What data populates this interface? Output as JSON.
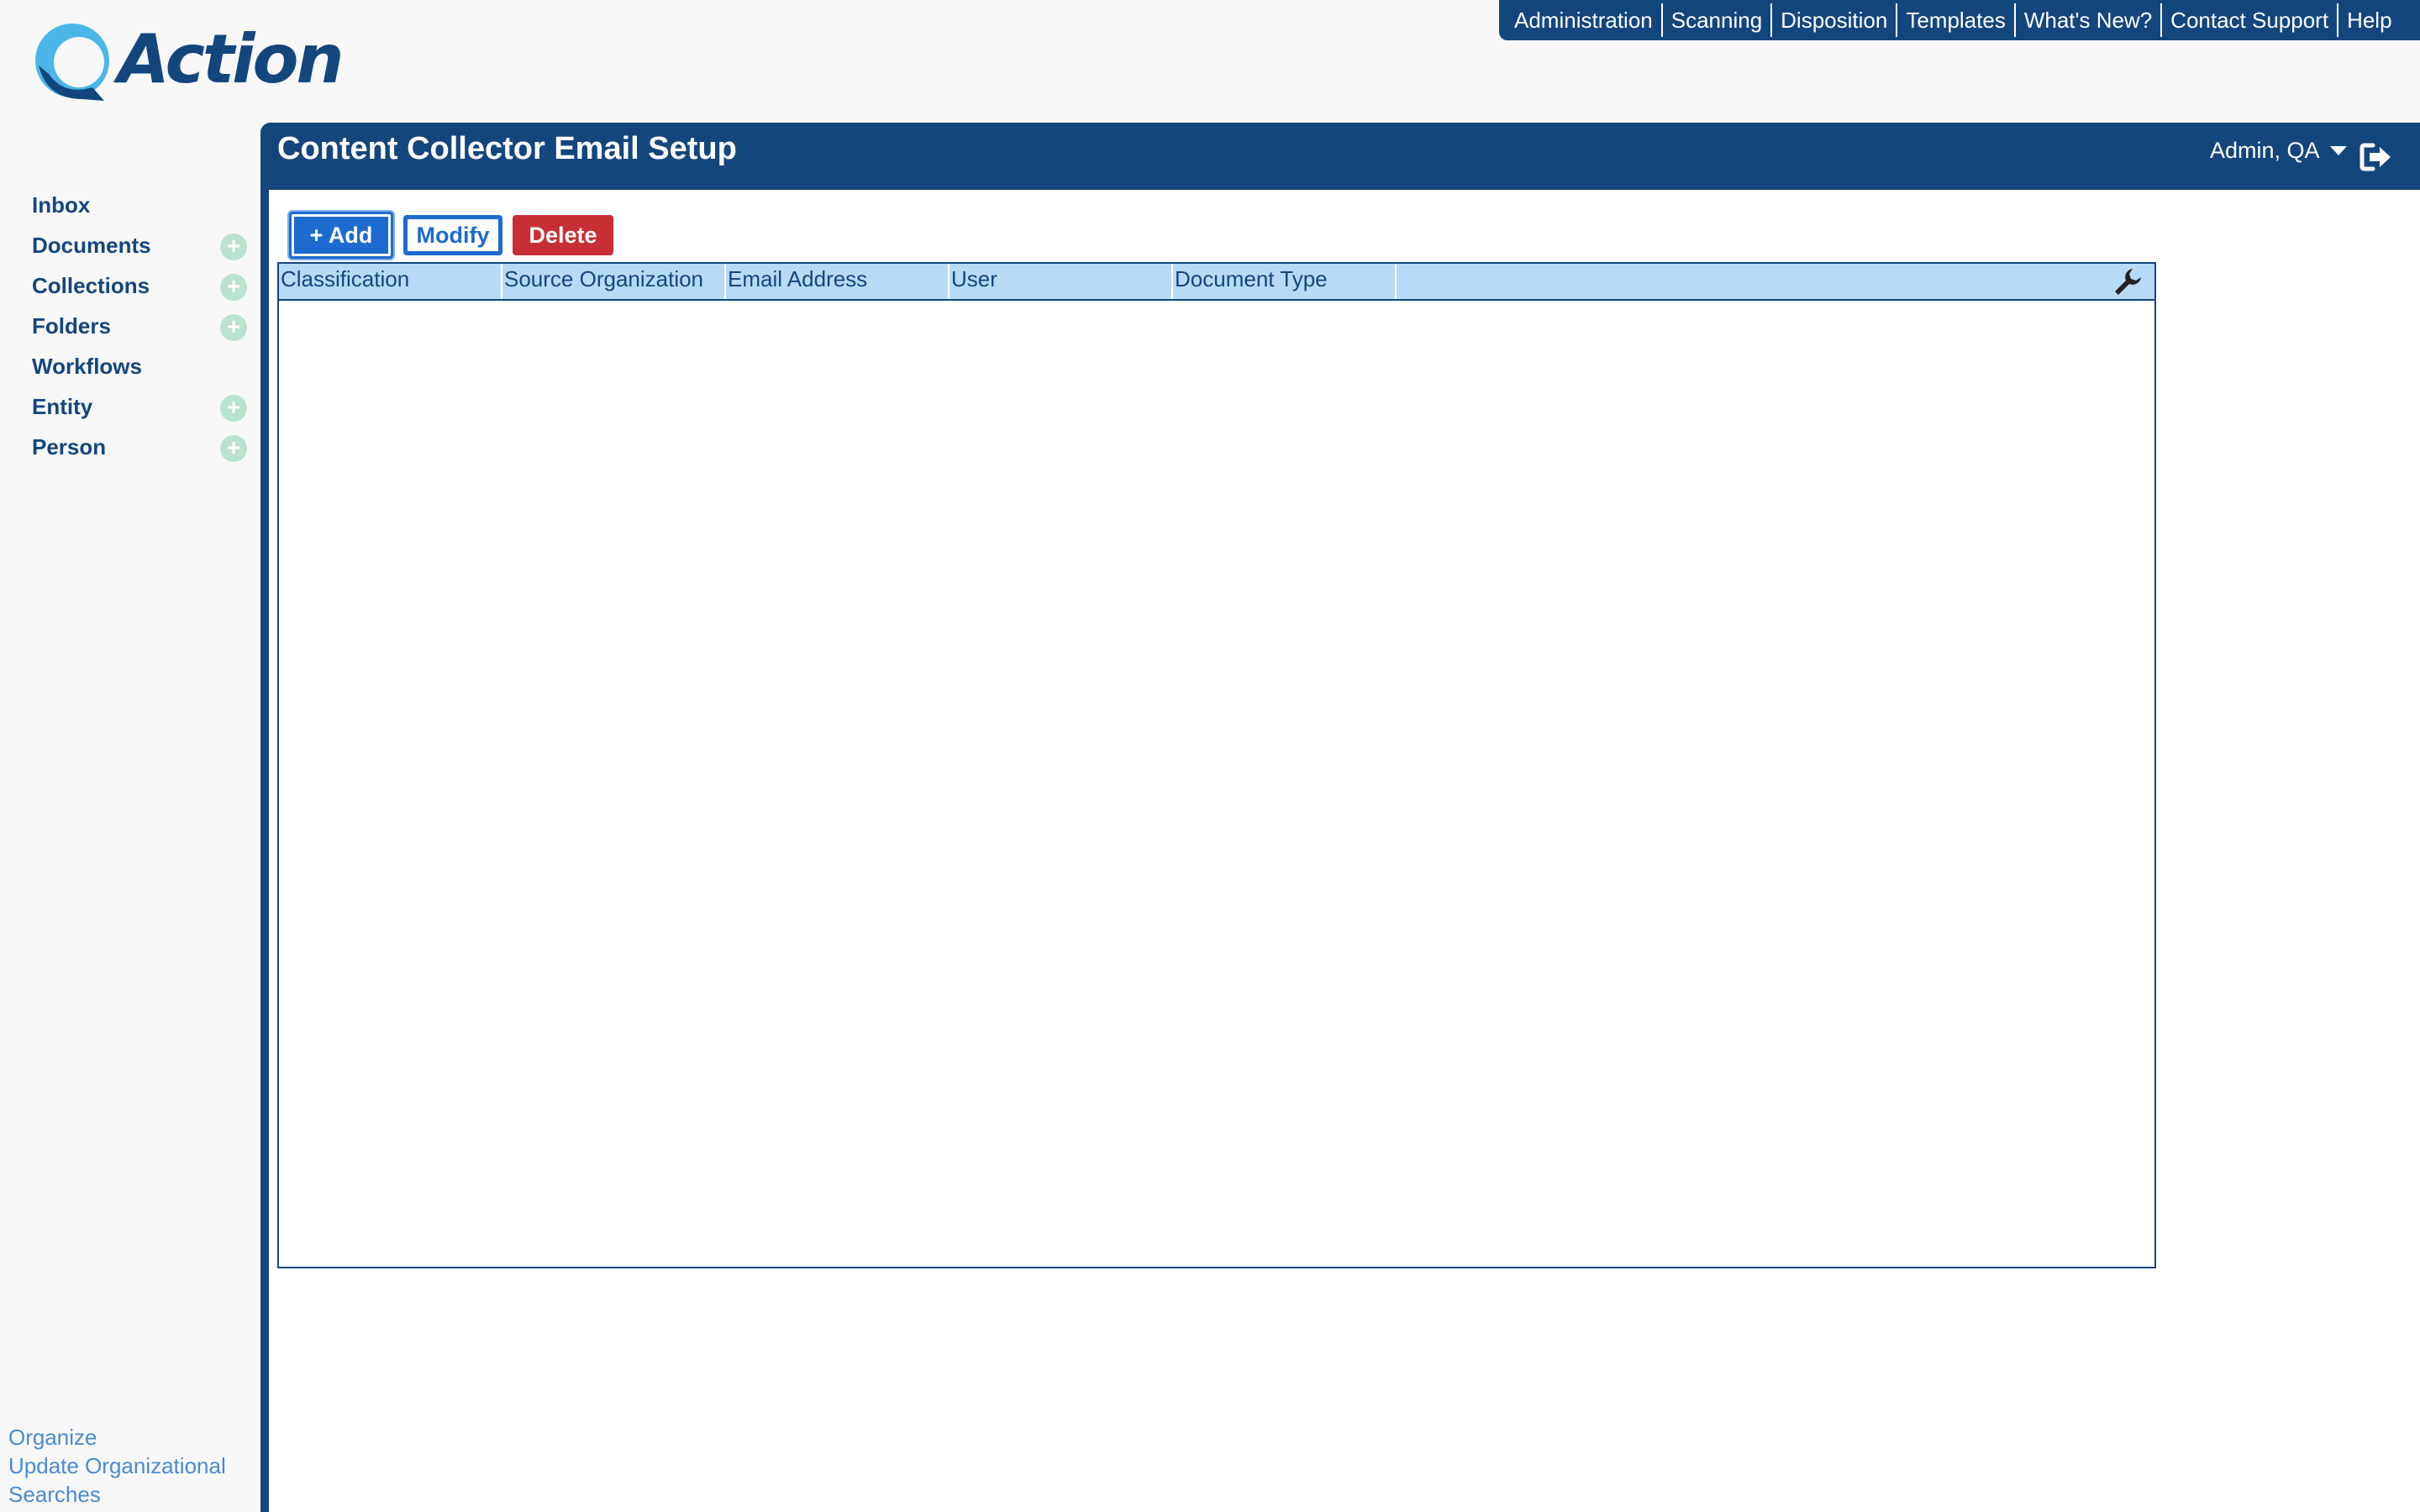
{
  "app": {
    "logo_text": "Action",
    "brand_color": "#14467e",
    "accent_color": "#1d6bd0"
  },
  "top_menu": {
    "items": [
      "Administration",
      "Scanning",
      "Disposition",
      "Templates",
      "What's New?",
      "Contact Support",
      "Help"
    ]
  },
  "sidebar": {
    "items": [
      {
        "label": "Inbox",
        "has_add": false
      },
      {
        "label": "Documents",
        "has_add": true
      },
      {
        "label": "Collections",
        "has_add": true
      },
      {
        "label": "Folders",
        "has_add": true
      },
      {
        "label": "Workflows",
        "has_add": false
      },
      {
        "label": "Entity",
        "has_add": true
      },
      {
        "label": "Person",
        "has_add": true
      }
    ],
    "add_glyph": "+",
    "bottom_links": [
      "Organize",
      "Update Organizational",
      "Searches"
    ]
  },
  "header": {
    "title": "Content Collector Email Setup",
    "user": "Admin, QA",
    "icons": {
      "user_menu": "caret-down-icon",
      "logout": "logout-icon"
    }
  },
  "toolbar": {
    "add_label": "+ Add",
    "modify_label": "Modify",
    "delete_label": "Delete",
    "delete_color": "#c82f34"
  },
  "grid": {
    "columns": [
      "Classification",
      "Source Organization",
      "Email Address",
      "User",
      "Document Type",
      ""
    ],
    "rows": [],
    "settings_icon": "wrench-icon"
  }
}
